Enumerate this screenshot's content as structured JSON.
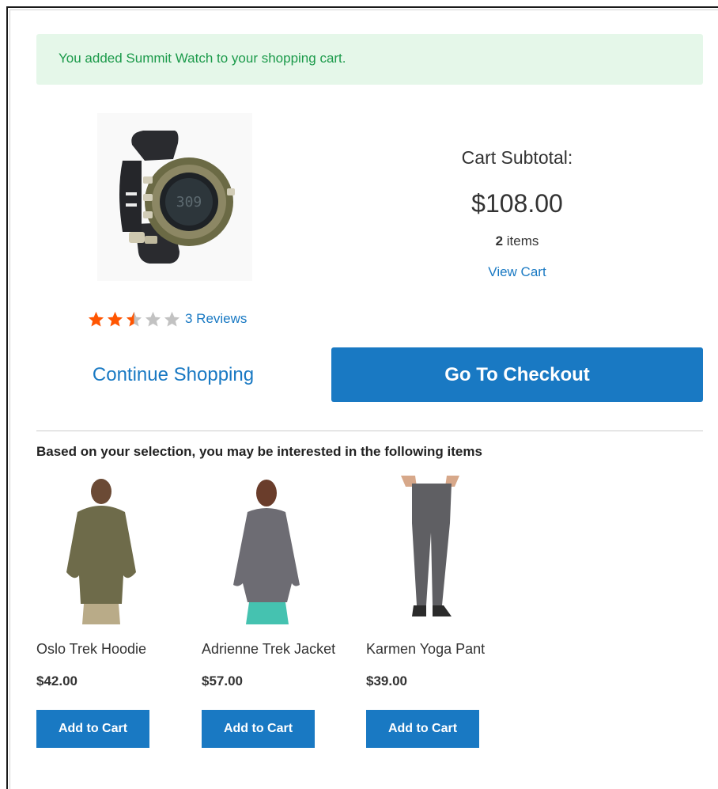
{
  "message": "You added Summit Watch to your shopping cart.",
  "product": {
    "name": "Summit Watch",
    "rating_fraction": 0.5,
    "reviews_link": "3 Reviews"
  },
  "cart": {
    "subtotal_label": "Cart Subtotal:",
    "subtotal": "$108.00",
    "items_count": "2",
    "items_word": "items",
    "view_cart": "View Cart"
  },
  "actions": {
    "continue_shopping": "Continue Shopping",
    "checkout": "Go To Checkout"
  },
  "related": {
    "title": "Based on your selection, you may be interested in the following items",
    "items": [
      {
        "name": "Oslo Trek Hoodie",
        "price": "$42.00",
        "button": "Add to Cart"
      },
      {
        "name": "Adrienne Trek Jacket",
        "price": "$57.00",
        "button": "Add to Cart"
      },
      {
        "name": "Karmen Yoga Pant",
        "price": "$39.00",
        "button": "Add to Cart"
      }
    ]
  },
  "colors": {
    "accent": "#1979c3",
    "success_bg": "#e5f7e9",
    "success_text": "#1b9a4a",
    "star_filled": "#ff5501",
    "star_empty": "#c2c2c2"
  }
}
